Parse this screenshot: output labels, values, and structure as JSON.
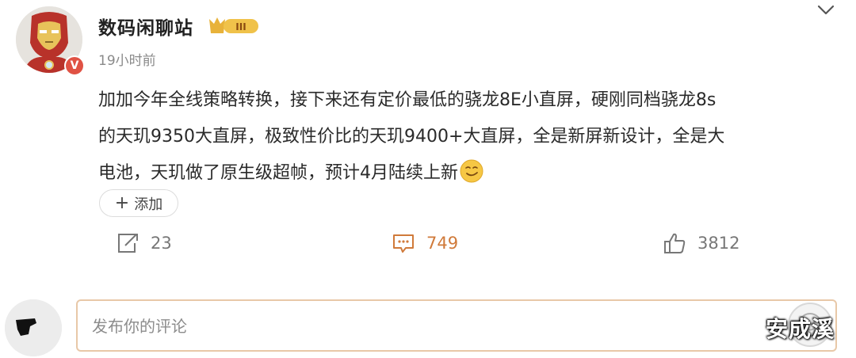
{
  "author": {
    "name": "数码闲聊站",
    "level_badge": "III",
    "verified_mark": "V",
    "avatar_icon": "iron-man-avatar"
  },
  "post": {
    "time": "19小时前",
    "lines": [
      "加加今年全线策略转换，接下来还有定价最低的骁龙8E小直屏，硬刚同档骁龙8s",
      "的天玑9350大直屏，极致性价比的天玑9400+大直屏，全是新屏新设计，全是大",
      "电池，天玑做了原生级超帧，预计4月陆续上新"
    ],
    "emoji": "smirk-emoji"
  },
  "tag": {
    "plus": "+",
    "label": "添加"
  },
  "actions": {
    "repost": {
      "icon": "repost-icon",
      "count": "23"
    },
    "comment": {
      "icon": "comment-icon",
      "count": "749"
    },
    "like": {
      "icon": "like-icon",
      "count": "3812"
    }
  },
  "comment_box": {
    "placeholder": "发布你的评论"
  },
  "watermark": "安成溪",
  "colors": {
    "accent_orange": "#d07a3a",
    "verified_red": "#e05244",
    "badge_gold": "#e8b23a"
  }
}
